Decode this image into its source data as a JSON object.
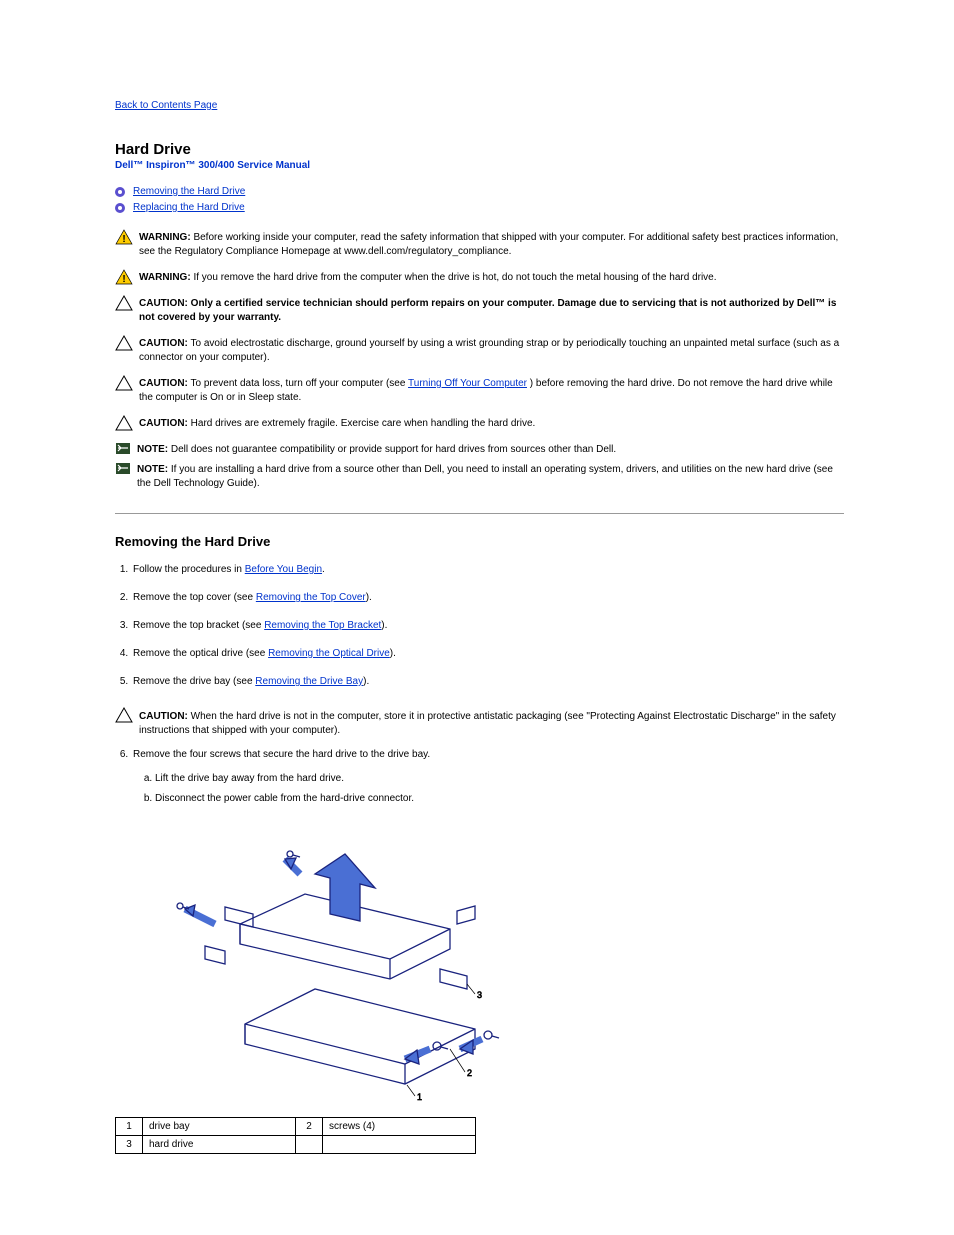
{
  "backLink": "Back to Contents Page",
  "sectionTitle": "Hard Drive",
  "manualTitle": "Dell™ Inspiron™ 300/400 Service Manual",
  "toc": [
    {
      "label": "Removing the Hard Drive"
    },
    {
      "label": "Replacing the Hard Drive"
    }
  ],
  "notices": [
    {
      "type": "warning",
      "prefix": "WARNING:",
      "body": "Before working inside your computer, read the safety information that shipped with your computer. For additional safety best practices information, see the Regulatory Compliance Homepage at www.dell.com/regulatory_compliance."
    },
    {
      "type": "warning",
      "prefix": "WARNING:",
      "body": "If you remove the hard drive from the computer when the drive is hot, do not touch the metal housing of the hard drive."
    },
    {
      "type": "caution",
      "prefix": "CAUTION:",
      "body": "Only a certified service technician should perform repairs on your computer. Damage due to servicing that is not authorized by Dell™ is not covered by your warranty."
    },
    {
      "type": "caution",
      "prefix": "CAUTION:",
      "body": "To avoid electrostatic discharge, ground yourself by using a wrist grounding strap or by periodically touching an unpainted metal surface (such as a connector on your computer)."
    },
    {
      "type": "caution",
      "prefix": "CAUTION:",
      "body": "To prevent data loss, turn off your computer (see ",
      "link": "Turning Off Your Computer",
      "body2": ") before removing the hard drive. Do not remove the hard drive while the computer is On or in Sleep state."
    },
    {
      "type": "caution",
      "prefix": "CAUTION:",
      "body": "Hard drives are extremely fragile. Exercise care when handling the hard drive."
    },
    {
      "type": "note",
      "prefix": "NOTE:",
      "body": "Dell does not guarantee compatibility or provide support for hard drives from sources other than Dell."
    },
    {
      "type": "note",
      "prefix": "NOTE:",
      "body": "If you are installing a hard drive from a source other than Dell, you need to install an operating system, drivers, and utilities on the new hard drive (see the Dell Technology Guide)."
    }
  ],
  "removeTitle": "Removing the Hard Drive",
  "steps": [
    {
      "pre": "Follow the procedures in ",
      "link": "Before You Begin",
      "post": "."
    },
    {
      "pre": "Remove the top cover (see ",
      "link": "Removing the Top Cover",
      "post": ")."
    },
    {
      "pre": "Remove the top bracket (see ",
      "link": "Removing the Top Bracket",
      "post": ")."
    },
    {
      "pre": "Remove the optical drive (see ",
      "link": "Removing the Optical Drive",
      "post": ")."
    },
    {
      "pre": "Remove the drive bay (see ",
      "link": "Removing the Drive Bay",
      "post": ")."
    }
  ],
  "midCaution": {
    "prefix": "CAUTION:",
    "body": "When the hard drive is not in the computer, store it in protective antistatic packaging (see \"Protecting Against Electrostatic Discharge\" in the safety instructions that shipped with your computer)."
  },
  "step6": {
    "intro": "Remove the four screws that secure the hard drive to the drive bay.",
    "subs": [
      "Lift the drive bay away from the hard drive.",
      "Disconnect the power cable from the hard-drive connector."
    ]
  },
  "legend": [
    {
      "n": "1",
      "label": "drive bay"
    },
    {
      "n": "2",
      "label": "screws (4)"
    },
    {
      "n": "3",
      "label": "hard drive"
    }
  ]
}
